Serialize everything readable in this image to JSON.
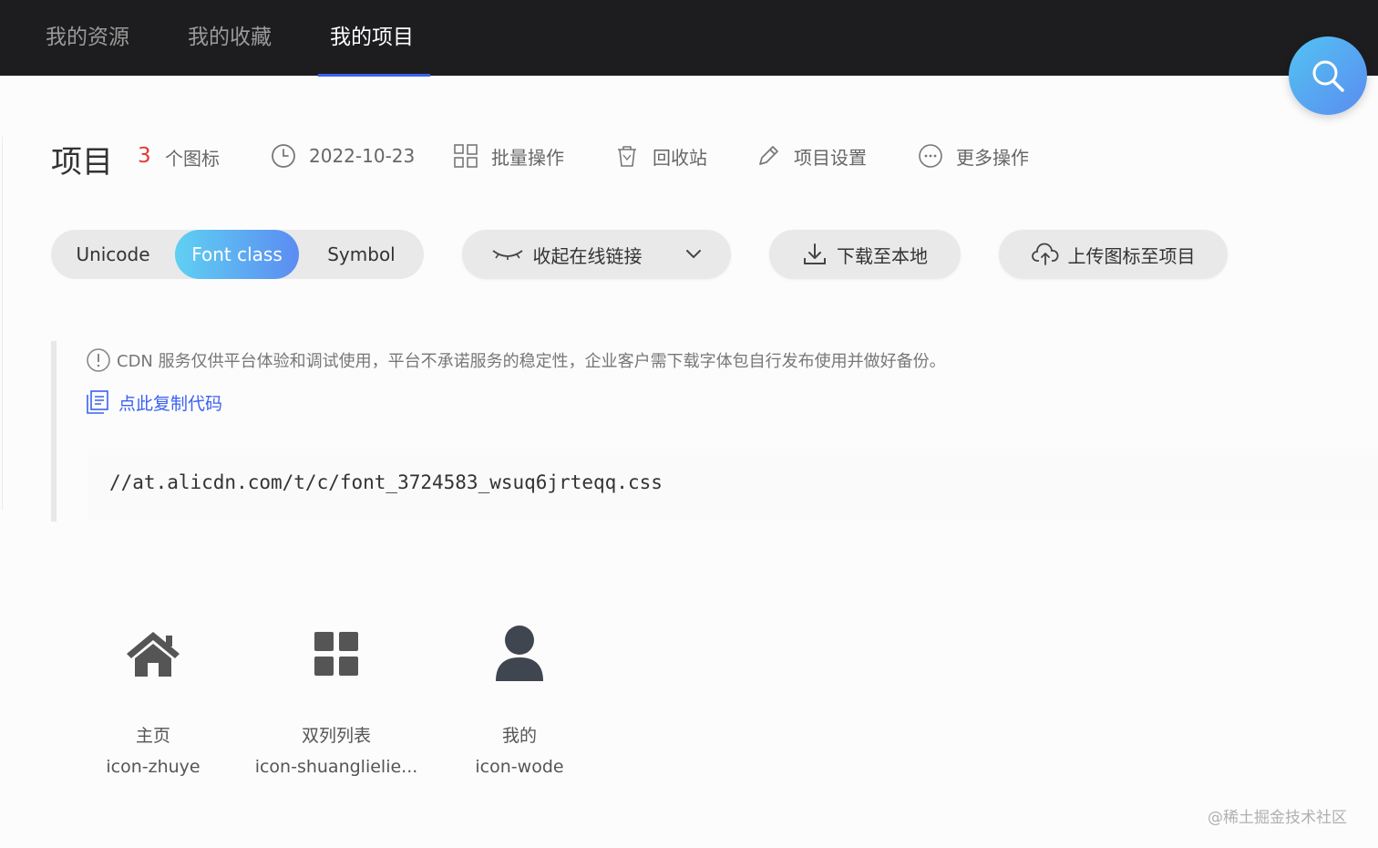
{
  "nav": {
    "tabs": [
      {
        "label": "我的资源"
      },
      {
        "label": "我的收藏"
      },
      {
        "label": "我的项目"
      }
    ],
    "active_tab": 2
  },
  "project": {
    "title": "项目",
    "icon_count": "3",
    "icon_unit": "个图标",
    "date": "2022-10-23",
    "actions": {
      "batch": "批量操作",
      "trash": "回收站",
      "settings": "项目设置",
      "more": "更多操作"
    }
  },
  "toolbar": {
    "modes": [
      "Unicode",
      "Font class",
      "Symbol"
    ],
    "active_mode": 1,
    "collapse_link": "收起在线链接",
    "download": "下载至本地",
    "upload": "上传图标至项目"
  },
  "cdn": {
    "notice": "CDN 服务仅供平台体验和调试使用，平台不承诺服务的稳定性，企业客户需下载字体包自行发布使用并做好备份。",
    "copy_label": "点此复制代码",
    "url": "//at.alicdn.com/t/c/font_3724583_wsuq6jrteqq.css"
  },
  "icons": [
    {
      "name": "主页",
      "class": "icon-zhuye",
      "icon": "home-icon"
    },
    {
      "name": "双列列表",
      "class": "icon-shuanglielie...",
      "icon": "grid-icon"
    },
    {
      "name": "我的",
      "class": "icon-wode",
      "icon": "user-icon"
    }
  ],
  "colors": {
    "accent": "#3b62f0",
    "count_red": "#e53935",
    "nav_bg": "#1d1d1f"
  },
  "watermark": "@稀土掘金技术社区"
}
